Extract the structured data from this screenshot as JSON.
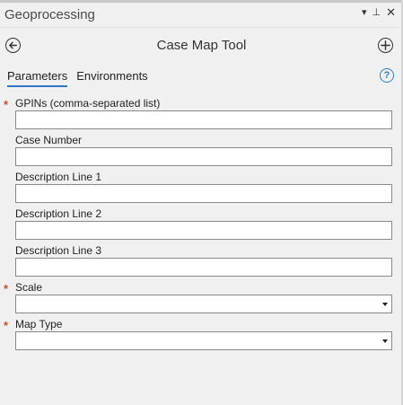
{
  "pane": {
    "title": "Geoprocessing",
    "menu_glyph": "▾",
    "pin_glyph": "⊥",
    "close_glyph": "✕"
  },
  "tool": {
    "title": "Case Map Tool",
    "back_icon": "back-arrow-icon",
    "add_icon": "add-icon"
  },
  "tabs": [
    {
      "label": "Parameters",
      "active": true
    },
    {
      "label": "Environments",
      "active": false
    }
  ],
  "help": {
    "glyph": "?"
  },
  "params": [
    {
      "label": "GPINs (comma-separated list)",
      "required": true,
      "type": "text",
      "value": ""
    },
    {
      "label": "Case Number",
      "required": false,
      "type": "text",
      "value": ""
    },
    {
      "label": "Description Line 1",
      "required": false,
      "type": "text",
      "value": ""
    },
    {
      "label": "Description Line 2",
      "required": false,
      "type": "text",
      "value": ""
    },
    {
      "label": "Description Line 3",
      "required": false,
      "type": "text",
      "value": ""
    },
    {
      "label": "Scale",
      "required": true,
      "type": "dropdown",
      "value": ""
    },
    {
      "label": "Map Type",
      "required": true,
      "type": "dropdown",
      "value": ""
    }
  ],
  "required_marker": "*",
  "colors": {
    "accent": "#2f76c5",
    "required": "#c8502a",
    "help": "#2d7fd1"
  }
}
